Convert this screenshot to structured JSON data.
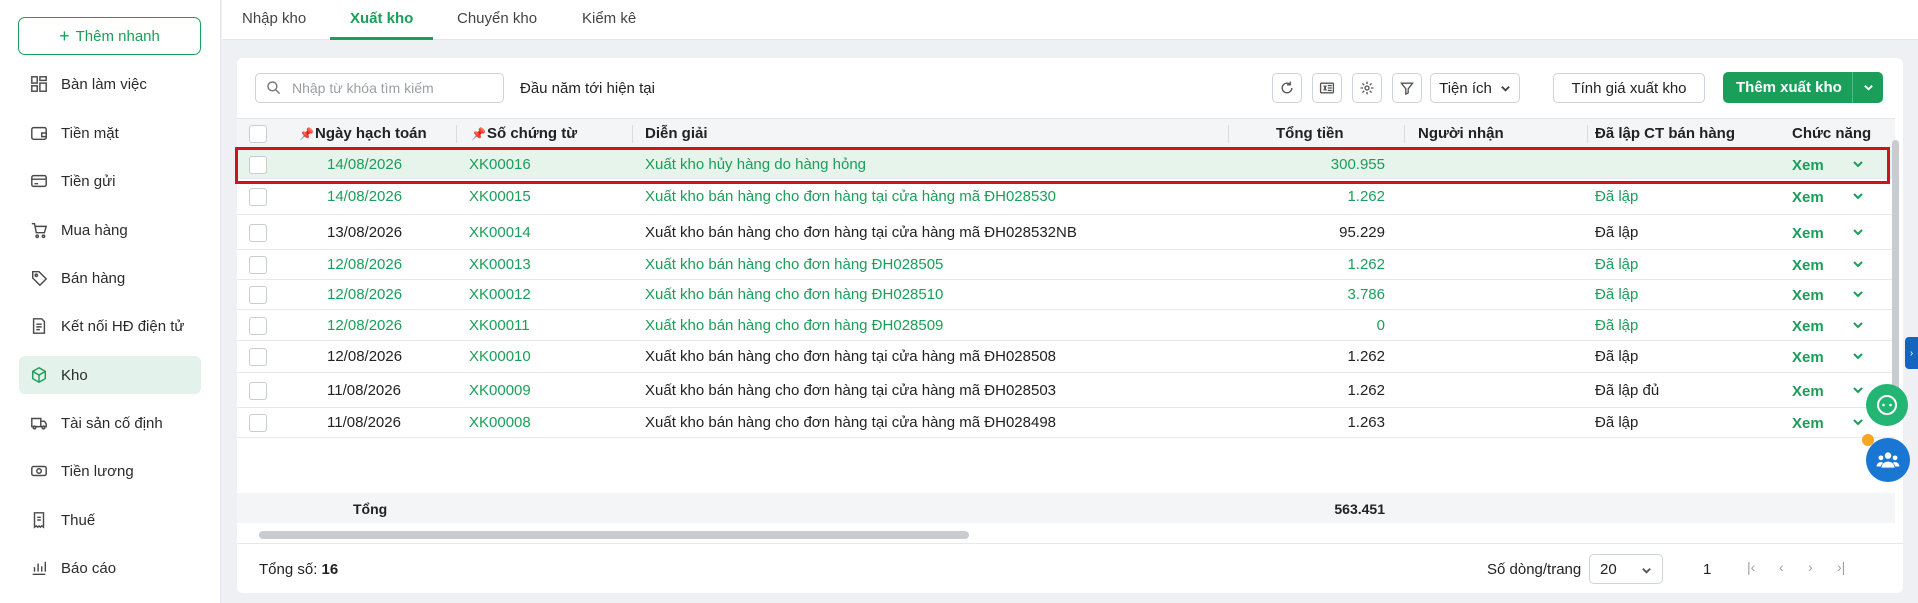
{
  "sidebar": {
    "quick_add": "Thêm nhanh",
    "items": [
      {
        "label": "Bàn làm việc",
        "icon": "dashboard-icon"
      },
      {
        "label": "Tiền mặt",
        "icon": "wallet-icon"
      },
      {
        "label": "Tiền gửi",
        "icon": "bank-card-icon"
      },
      {
        "label": "Mua hàng",
        "icon": "cart-icon"
      },
      {
        "label": "Bán hàng",
        "icon": "tag-icon"
      },
      {
        "label": "Kết nối HĐ điện tử",
        "icon": "invoice-icon"
      },
      {
        "label": "Kho",
        "icon": "box-icon",
        "active": true
      },
      {
        "label": "Tài sản cố định",
        "icon": "truck-icon"
      },
      {
        "label": "Tiền lương",
        "icon": "salary-icon"
      },
      {
        "label": "Thuế",
        "icon": "tax-icon"
      },
      {
        "label": "Báo cáo",
        "icon": "report-icon"
      }
    ]
  },
  "tabs": [
    {
      "label": "Nhập kho",
      "active": false
    },
    {
      "label": "Xuất kho",
      "active": true
    },
    {
      "label": "Chuyển kho",
      "active": false
    },
    {
      "label": "Kiểm kê",
      "active": false
    }
  ],
  "toolbar": {
    "search_placeholder": "Nhập từ khóa tìm kiếm",
    "period": "Đầu năm tới hiện tại",
    "utilities_label": "Tiện ích",
    "calc_price_label": "Tính giá xuất kho",
    "add_label": "Thêm xuất kho"
  },
  "table": {
    "headers": {
      "date": "Ngày hạch toán",
      "voucher": "Số chứng từ",
      "description": "Diễn giải",
      "total": "Tổng tiền",
      "receiver": "Người nhận",
      "sales_doc": "Đã lập CT bán hàng",
      "actions": "Chức năng"
    },
    "rows": [
      {
        "date": "14/08/2026",
        "voucher": "XK00016",
        "description": "Xuất kho hủy hàng do hàng hỏng",
        "total": "300.955",
        "receiver": "",
        "sales_doc": "",
        "action": "Xem",
        "green": true
      },
      {
        "date": "14/08/2026",
        "voucher": "XK00015",
        "description": "Xuất kho bán hàng cho đơn hàng tại cửa hàng mã ĐH028530",
        "total": "1.262",
        "receiver": "",
        "sales_doc": "Đã lập",
        "action": "Xem",
        "green": true
      },
      {
        "date": "13/08/2026",
        "voucher": "XK00014",
        "description": "Xuất kho bán hàng cho đơn hàng tại cửa hàng mã ĐH028532NB",
        "total": "95.229",
        "receiver": "",
        "sales_doc": "Đã lập",
        "action": "Xem",
        "green": false
      },
      {
        "date": "12/08/2026",
        "voucher": "XK00013",
        "description": "Xuất kho bán hàng cho đơn hàng  ĐH028505",
        "total": "1.262",
        "receiver": "",
        "sales_doc": "Đã lập",
        "action": "Xem",
        "green": true
      },
      {
        "date": "12/08/2026",
        "voucher": "XK00012",
        "description": "Xuất kho bán hàng cho đơn hàng  ĐH028510",
        "total": "3.786",
        "receiver": "",
        "sales_doc": "Đã lập",
        "action": "Xem",
        "green": true
      },
      {
        "date": "12/08/2026",
        "voucher": "XK00011",
        "description": "Xuất kho bán hàng cho đơn hàng  ĐH028509",
        "total": "0",
        "receiver": "",
        "sales_doc": "Đã lập",
        "action": "Xem",
        "green": true
      },
      {
        "date": "12/08/2026",
        "voucher": "XK00010",
        "description": "Xuất kho bán hàng cho đơn hàng tại cửa hàng mã ĐH028508",
        "total": "1.262",
        "receiver": "",
        "sales_doc": "Đã lập",
        "action": "Xem",
        "green": false
      },
      {
        "date": "11/08/2026",
        "voucher": "XK00009",
        "description": "Xuất kho bán hàng cho đơn hàng tại cửa hàng mã ĐH028503",
        "total": "1.262",
        "receiver": "",
        "sales_doc": "Đã lập đủ",
        "action": "Xem",
        "green": false
      },
      {
        "date": "11/08/2026",
        "voucher": "XK00008",
        "description": "Xuất kho bán hàng cho đơn hàng tại cửa hàng mã ĐH028498",
        "total": "1.263",
        "receiver": "",
        "sales_doc": "Đã lập",
        "action": "Xem",
        "green": false
      }
    ],
    "total_label": "Tổng",
    "total_value": "563.451"
  },
  "footer": {
    "count_label": "Tổng số:",
    "count_value": "16",
    "rows_per_page_label": "Số dòng/trang",
    "rows_per_page": "20",
    "page": "1"
  },
  "colors": {
    "accent": "#1b9e5a",
    "highlight_border": "#d0121b"
  }
}
